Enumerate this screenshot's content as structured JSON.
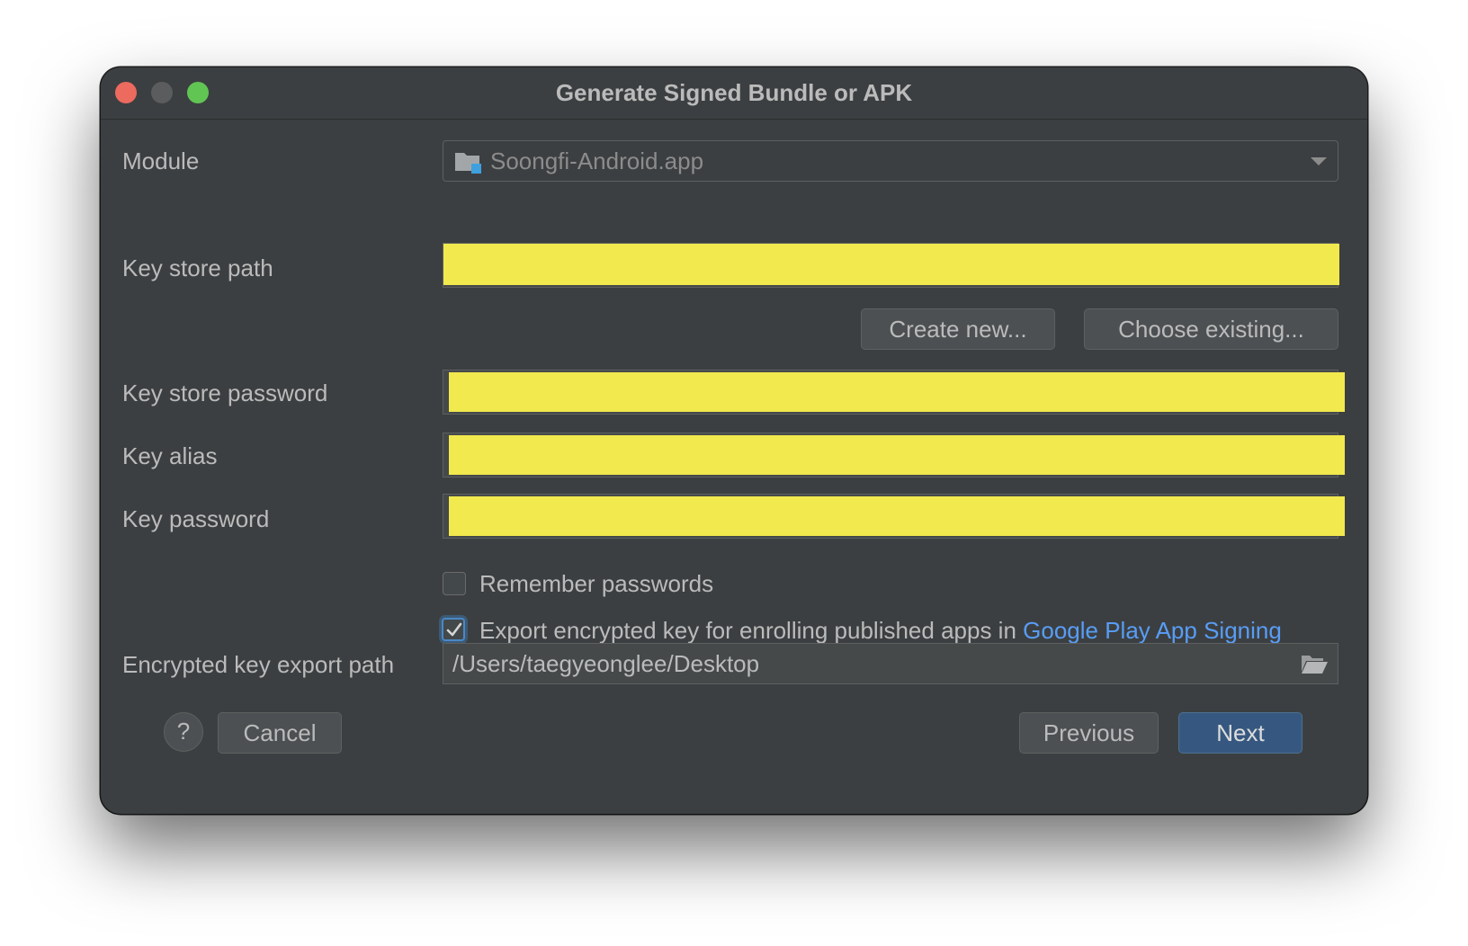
{
  "window": {
    "title": "Generate Signed Bundle or APK"
  },
  "module": {
    "label": "Module",
    "value": "Soongfi-Android.app"
  },
  "keystore": {
    "path_label": "Key store path",
    "create_new_label": "Create new...",
    "choose_existing_label": "Choose existing...",
    "password_label": "Key store password",
    "alias_label": "Key alias",
    "key_password_label": "Key password"
  },
  "options": {
    "remember_passwords_label": "Remember passwords",
    "remember_passwords_checked": false,
    "export_key_label": "Export encrypted key for enrolling published apps in",
    "export_key_link": "Google Play App Signing",
    "export_key_checked": true
  },
  "export_path": {
    "label": "Encrypted key export path",
    "value": "/Users/taegyeonglee/Desktop"
  },
  "footer": {
    "help_label": "?",
    "cancel_label": "Cancel",
    "previous_label": "Previous",
    "next_label": "Next"
  },
  "colors": {
    "background": "#3c3f41",
    "redaction": "#f1e94d",
    "link": "#589df6",
    "primary_button": "#365880"
  }
}
